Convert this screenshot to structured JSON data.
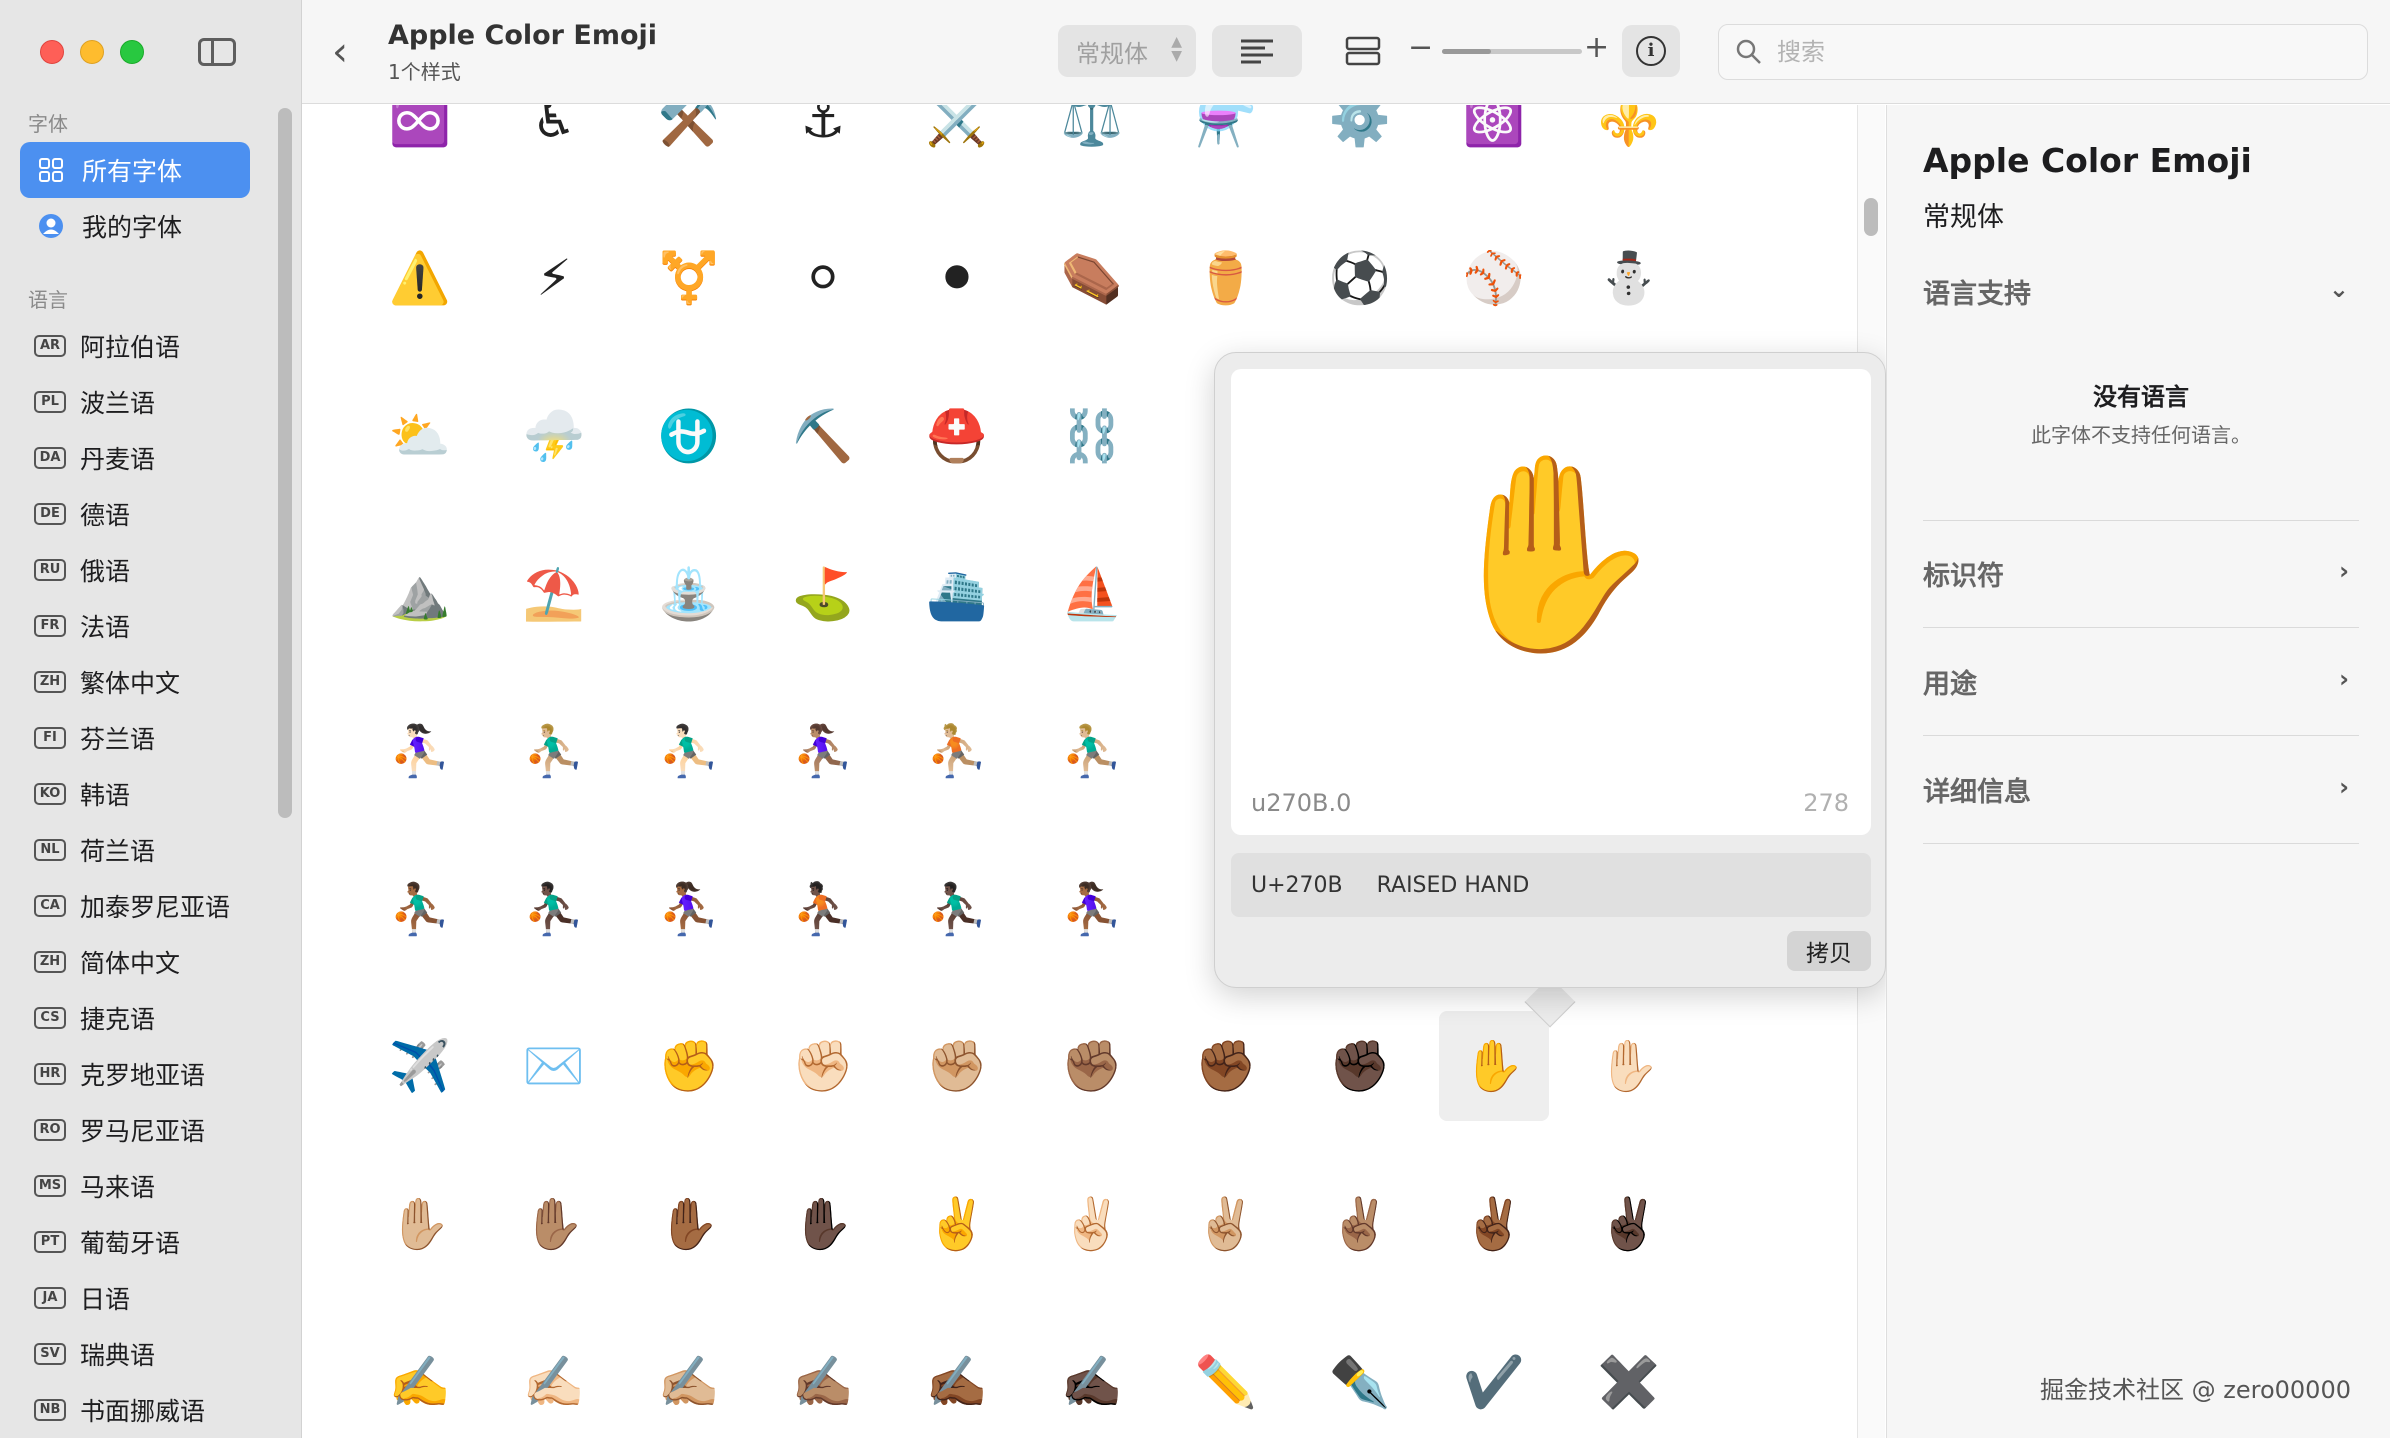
{
  "sidebar": {
    "fonts_section": "字体",
    "all_fonts": "所有字体",
    "my_fonts": "我的字体",
    "language_section": "语言",
    "languages": [
      {
        "code": "AR",
        "name": "阿拉伯语"
      },
      {
        "code": "PL",
        "name": "波兰语"
      },
      {
        "code": "DA",
        "name": "丹麦语"
      },
      {
        "code": "DE",
        "name": "德语"
      },
      {
        "code": "RU",
        "name": "俄语"
      },
      {
        "code": "FR",
        "name": "法语"
      },
      {
        "code": "ZH",
        "name": "繁体中文"
      },
      {
        "code": "FI",
        "name": "芬兰语"
      },
      {
        "code": "KO",
        "name": "韩语"
      },
      {
        "code": "NL",
        "name": "荷兰语"
      },
      {
        "code": "CA",
        "name": "加泰罗尼亚语"
      },
      {
        "code": "ZH",
        "name": "简体中文"
      },
      {
        "code": "CS",
        "name": "捷克语"
      },
      {
        "code": "HR",
        "name": "克罗地亚语"
      },
      {
        "code": "RO",
        "name": "罗马尼亚语"
      },
      {
        "code": "MS",
        "name": "马来语"
      },
      {
        "code": "PT",
        "name": "葡萄牙语"
      },
      {
        "code": "JA",
        "name": "日语"
      },
      {
        "code": "SV",
        "name": "瑞典语"
      },
      {
        "code": "NB",
        "name": "书面挪威语"
      }
    ]
  },
  "toolbar": {
    "title": "Apple Color Emoji",
    "subtitle": "1个样式",
    "style_value": "常规体",
    "zoom_level": 0.35,
    "search_placeholder": "搜索"
  },
  "glyph_grid": {
    "rows": [
      [
        "♾️",
        "♿",
        "⚒️",
        "⚓",
        "⚔️",
        "⚖️",
        "⚗️",
        "⚙️",
        "⚛️",
        "⚜️"
      ],
      [
        "⚠️",
        "⚡",
        "⚧️",
        "⚪",
        "⚫",
        "⚰️",
        "⚱️",
        "⚽",
        "⚾",
        "⛄"
      ],
      [
        "⛅",
        "⛈️",
        "⛎",
        "⛏️",
        "⛑️",
        "⛓️",
        "",
        "",
        "",
        ""
      ],
      [
        "⛰️",
        "⛱️",
        "⛲",
        "⛳",
        "⛴️",
        "⛵",
        "",
        "",
        "",
        ""
      ],
      [
        "⛹🏻‍♀️",
        "⛹🏼‍♂️",
        "⛹🏻‍♂️",
        "⛹🏽‍♀️",
        "⛹🏼",
        "⛹🏼‍♂️",
        "",
        "",
        "",
        ""
      ],
      [
        "⛹🏾‍♂️",
        "⛹🏿‍♂️",
        "⛹🏾‍♀️",
        "⛹🏿",
        "⛹🏿‍♂️",
        "⛹🏾‍♀️",
        "",
        "",
        "",
        ""
      ],
      [
        "✈️",
        "✉️",
        "✊",
        "✊🏻",
        "✊🏼",
        "✊🏽",
        "✊🏾",
        "✊🏿",
        "✋",
        "✋🏻"
      ],
      [
        "✋🏼",
        "✋🏽",
        "✋🏾",
        "✋🏿",
        "✌️",
        "✌🏻",
        "✌🏼",
        "✌🏽",
        "✌🏾",
        "✌🏿"
      ],
      [
        "✍️",
        "✍🏻",
        "✍🏼",
        "✍🏽",
        "✍🏾",
        "✍🏿",
        "✏️",
        "✒️",
        "✔️",
        "✖️"
      ]
    ]
  },
  "popover": {
    "glyph": "✋",
    "glyph_name": "u270B.0",
    "glyph_index": "278",
    "unicode": "U+270B",
    "unicode_name": "RAISED HAND",
    "copy_label": "拷贝"
  },
  "inspector": {
    "font_name": "Apple Color Emoji",
    "style": "常规体",
    "language_support": "语言支持",
    "no_language_title": "没有语言",
    "no_language_desc": "此字体不支持任何语言。",
    "identifier": "标识符",
    "usage": "用途",
    "details": "详细信息"
  },
  "watermark": "掘金技术社区 @ zero00000",
  "colors": {
    "accent": "#4c90f0",
    "sidebar_bg": "#e6e6e6"
  }
}
